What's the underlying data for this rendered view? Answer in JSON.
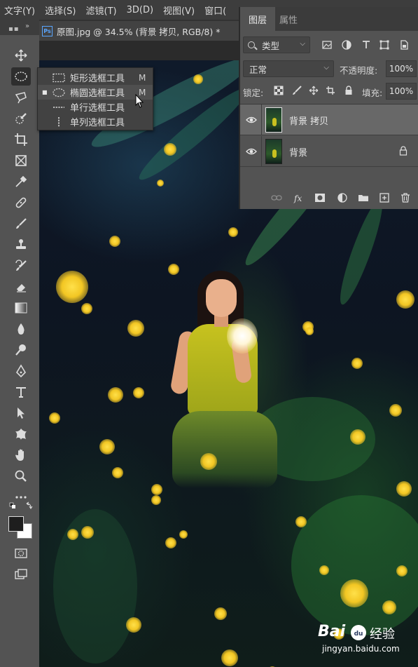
{
  "menubar": {
    "items": [
      "文字(Y)",
      "选择(S)",
      "滤镜(T)",
      "3D(D)",
      "视图(V)",
      "窗口("
    ]
  },
  "document": {
    "tab_title": "原图.jpg @ 34.5% (背景 拷贝, RGB/8) *",
    "app_badge": "Ps"
  },
  "tools": [
    "move-tool",
    "elliptical-marquee-tool",
    "lasso-tool",
    "quick-selection-tool",
    "crop-tool",
    "frame-tool",
    "eyedropper-tool",
    "healing-brush-tool",
    "brush-tool",
    "clone-stamp-tool",
    "history-brush-tool",
    "eraser-tool",
    "gradient-tool",
    "blur-tool",
    "dodge-tool",
    "pen-tool",
    "type-tool",
    "path-selection-tool",
    "custom-shape-tool",
    "hand-tool",
    "zoom-tool",
    "more-tools",
    "swap-colors",
    "foreground-background-color",
    "quick-mask",
    "screen-mode"
  ],
  "flyout": {
    "items": [
      {
        "label": "矩形选框工具",
        "shortcut": "M",
        "icon": "rect-marquee-icon",
        "selected": false
      },
      {
        "label": "椭圆选框工具",
        "shortcut": "M",
        "icon": "ellipse-marquee-icon",
        "selected": true
      },
      {
        "label": "单行选框工具",
        "shortcut": "",
        "icon": "single-row-marquee-icon",
        "selected": false
      },
      {
        "label": "单列选框工具",
        "shortcut": "",
        "icon": "single-column-marquee-icon",
        "selected": false
      }
    ]
  },
  "layers_panel": {
    "tabs": [
      "图层",
      "属性"
    ],
    "filter_value": "类型",
    "blend_mode": "正常",
    "opacity_label": "不透明度:",
    "opacity_value": "100%",
    "lock_label": "锁定:",
    "fill_label": "填充:",
    "fill_value": "100%",
    "layers": [
      {
        "name": "背景 拷贝",
        "selected": true,
        "visible": true,
        "locked": false
      },
      {
        "name": "背景",
        "selected": false,
        "visible": true,
        "locked": true
      }
    ]
  },
  "watermark": {
    "brand": "Bai",
    "brand_suffix": "du",
    "chinese": "经验",
    "url": "jingyan.baidu.com"
  },
  "colors": {
    "foreground": "#1e1e1e",
    "background": "#ffffff",
    "firefly": "#f2c623",
    "accent_blue": "#5aa6ff"
  }
}
